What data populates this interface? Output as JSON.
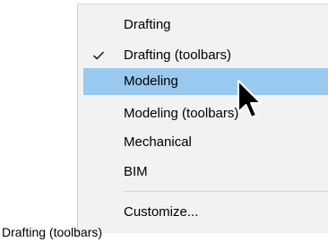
{
  "menu": {
    "items": [
      {
        "label": "Drafting",
        "checked": false,
        "highlighted": false
      },
      {
        "label": "Drafting (toolbars)",
        "checked": true,
        "highlighted": false
      },
      {
        "label": "Modeling",
        "checked": false,
        "highlighted": true
      },
      {
        "label": "Modeling (toolbars)",
        "checked": false,
        "highlighted": false
      },
      {
        "label": "Mechanical",
        "checked": false,
        "highlighted": false
      },
      {
        "label": "BIM",
        "checked": false,
        "highlighted": false
      },
      {
        "label": "Customize...",
        "checked": false,
        "highlighted": false
      }
    ],
    "check_icon": "checkmark-icon",
    "highlight_color": "#99c9ef",
    "background_color": "#f2f2f2"
  },
  "cursor_icon": "mouse-pointer-icon",
  "status": {
    "current_workspace": "Drafting (toolbars)"
  }
}
